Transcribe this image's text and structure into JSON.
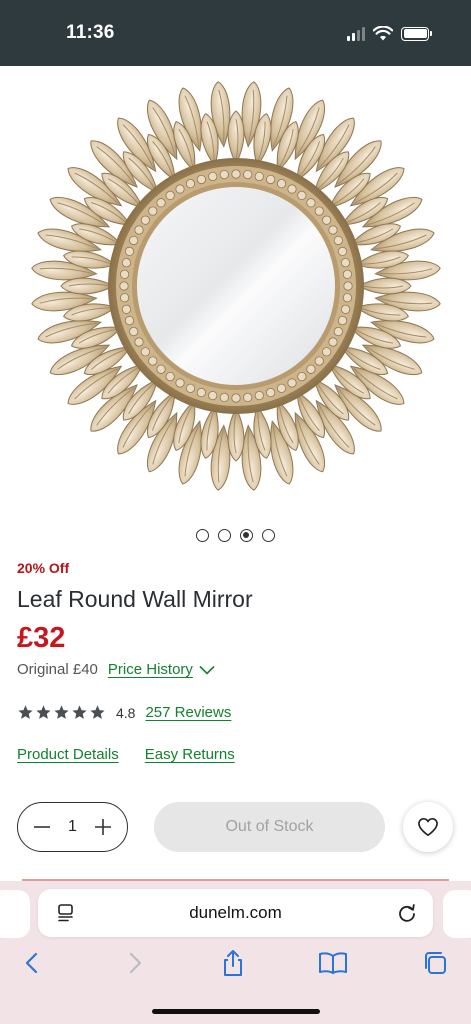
{
  "status_bar": {
    "time": "11:36"
  },
  "product": {
    "discount_label": "20% Off",
    "title": "Leaf Round Wall Mirror",
    "price": "£32",
    "original_price": "Original £40",
    "price_history_label": "Price History",
    "rating_value": "4.8",
    "rating_stars": 5,
    "reviews_label": "257 Reviews",
    "product_details_label": "Product Details",
    "easy_returns_label": "Easy Returns",
    "image_icon": "leaf-mirror-image"
  },
  "carousel": {
    "dot_count": 4,
    "active_index": 2
  },
  "actions": {
    "quantity": "1",
    "out_of_stock_label": "Out of Stock",
    "wishlist_icon": "heart-icon"
  },
  "browser": {
    "url": "dunelm.com",
    "toolbar_icons": [
      "back-icon",
      "forward-icon",
      "share-icon",
      "bookmarks-icon",
      "tabs-icon"
    ]
  },
  "colors": {
    "sale_red": "#c8161d",
    "link_green": "#13822e",
    "status_bar_bg": "#2f3a3e",
    "safari_bar_bg": "#f2e4e6"
  }
}
